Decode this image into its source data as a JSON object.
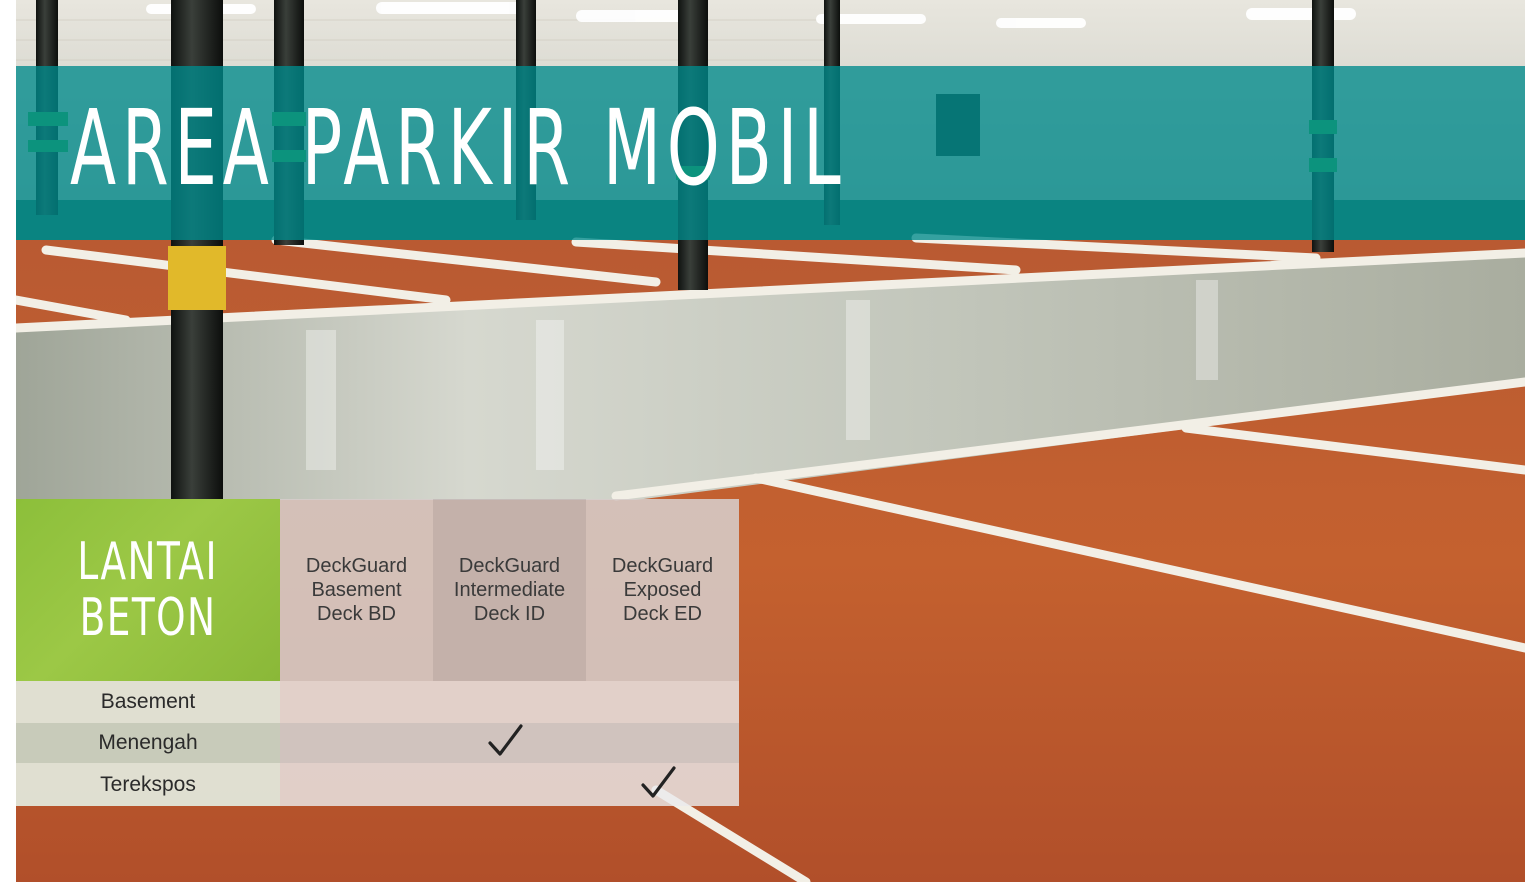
{
  "title": "AREA PARKIR MOBIL",
  "table": {
    "corner_label": [
      "LANTAI",
      "BETON"
    ],
    "columns": [
      [
        "DeckGuard",
        "Basement",
        "Deck BD"
      ],
      [
        "DeckGuard",
        "Intermediate",
        "Deck ID"
      ],
      [
        "DeckGuard",
        "Exposed",
        "Deck ED"
      ]
    ],
    "rows": [
      {
        "label": "Basement",
        "checks": [
          false,
          false,
          false
        ]
      },
      {
        "label": "Menengah",
        "checks": [
          false,
          true,
          false
        ]
      },
      {
        "label": "Terekspos",
        "checks": [
          false,
          false,
          true
        ]
      }
    ]
  },
  "colors": {
    "title_band": "#008a8c",
    "corner_green": "#8cbf3a",
    "floor_orange": "#c45a2e"
  },
  "icons": {
    "check": "check-icon"
  }
}
